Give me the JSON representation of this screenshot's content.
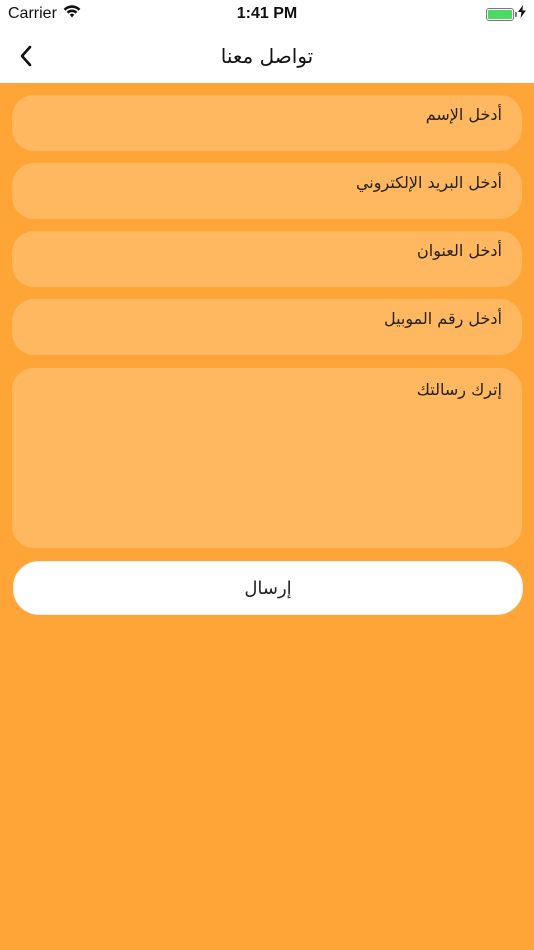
{
  "status_bar": {
    "carrier": "Carrier",
    "time": "1:41 PM"
  },
  "header": {
    "title": "تواصل معنا",
    "back_icon": "chevron-left-icon"
  },
  "form": {
    "name_placeholder": "أدخل الإسم",
    "email_placeholder": "أدخل البريد الإلكتروني",
    "address_placeholder": "أدخل العنوان",
    "mobile_placeholder": "أدخل رقم الموبيل",
    "message_placeholder": "إترك رسالتك",
    "submit_label": "إرسال"
  },
  "colors": {
    "background": "#ffa437",
    "field": "#ffb760",
    "button": "#ffffff"
  }
}
